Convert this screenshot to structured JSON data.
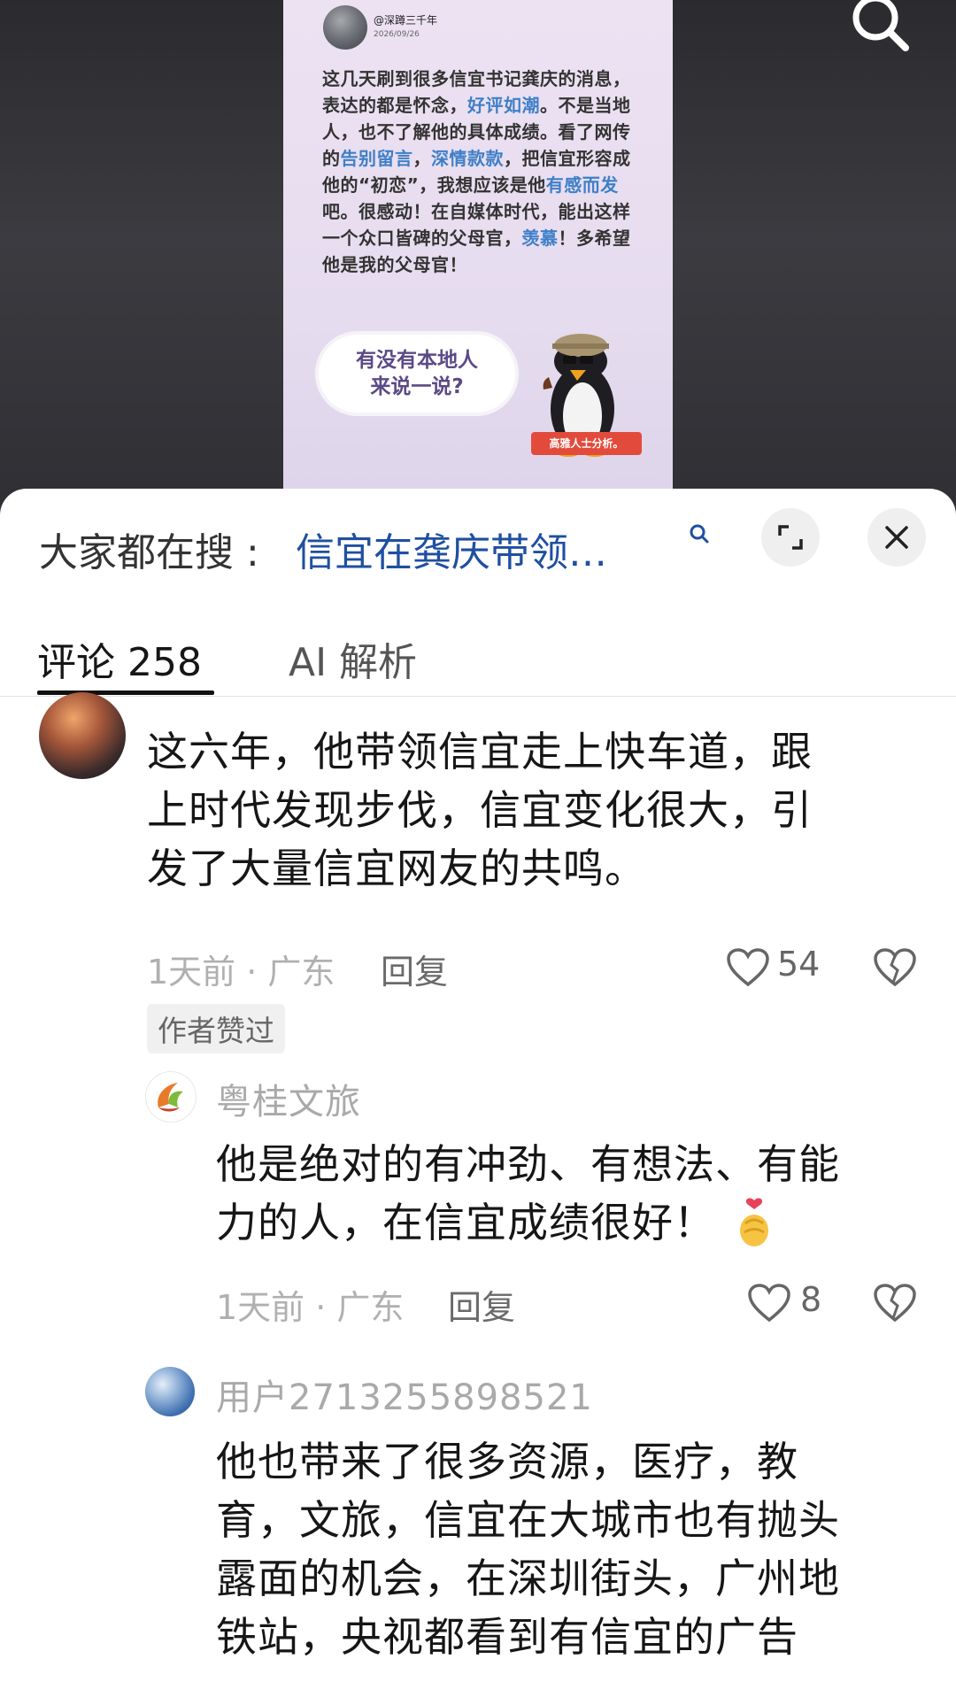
{
  "video": {
    "post_handle": "@深蹲三千年",
    "post_date": "2026/09/26",
    "post_text_parts": [
      {
        "t": "这几天刷到很多信宜书记龚庆的消息，表达的都是怀念，",
        "hl": false
      },
      {
        "t": "好评如潮",
        "hl": true
      },
      {
        "t": "。不是当地人，也不了解他的具体成绩。看了网传的",
        "hl": false
      },
      {
        "t": "告别留言",
        "hl": true
      },
      {
        "t": "，",
        "hl": false
      },
      {
        "t": "深情款款",
        "hl": true
      },
      {
        "t": "，把信宜形容成他的“初恋”，我想应该是他",
        "hl": false
      },
      {
        "t": "有感而发",
        "hl": true
      },
      {
        "t": "吧。很感动！在自媒体时代，能出这样一个众口皆碑的父母官，",
        "hl": false
      },
      {
        "t": "羡慕",
        "hl": true
      },
      {
        "t": "！多希望他是我的父母官！",
        "hl": false
      }
    ],
    "bubble_line1": "有没有本地人",
    "bubble_line2": "来说一说?",
    "penguin_tag": "高雅人士分析。"
  },
  "search": {
    "prefix": "大家都在搜 :",
    "query": "信宜在龚庆带领…"
  },
  "tabs": {
    "comments_label": "评论 258",
    "ai_label": "AI 解析"
  },
  "comments": [
    {
      "name": "",
      "text_lines": [
        "这六年，他带领信宜走上快车道，跟",
        "上时代发现步伐，信宜变化很大，引",
        "发了大量信宜网友的共鸣。"
      ],
      "meta": "1天前 · 广东",
      "reply": "回复",
      "likes": "54",
      "badge": "作者赞过"
    },
    {
      "name": "粤桂文旅",
      "text_lines": [
        "他是绝对的有冲劲、有想法、有能",
        "力的人，在信宜成绩很好！"
      ],
      "meta": "1天前 · 广东",
      "reply": "回复",
      "likes": "8"
    },
    {
      "name": "用户2713255898521",
      "text_lines": [
        "他也带来了很多资源，医疗，教",
        "育，文旅，信宜在大城市也有抛头",
        "露面的机会，在深圳街头，广州地",
        "铁站，央视都看到有信宜的广告"
      ]
    }
  ],
  "colors": {
    "link_blue": "#1f4fa0",
    "highlight_blue": "#3f7fc8",
    "tag_red": "#e24b3c"
  }
}
